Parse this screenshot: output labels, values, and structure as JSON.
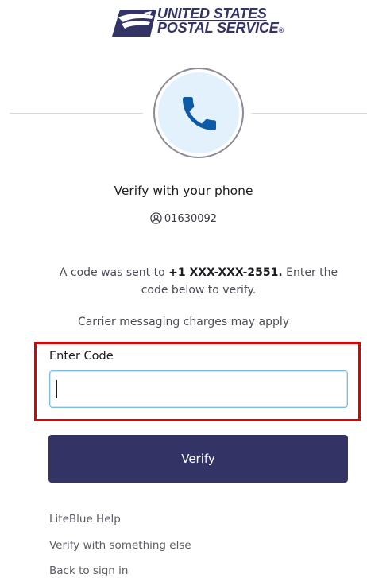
{
  "brand": {
    "line1": "UNITED STATES",
    "line2": "POSTAL SERVICE",
    "reg": "®",
    "logo_icon": "eagle-icon",
    "color": "#333366"
  },
  "header": {
    "icon": "phone-icon",
    "icon_color": "#0e5aa7",
    "circle_bg": "#e3f1fd"
  },
  "title": "Verify with your phone",
  "user": {
    "icon": "user-circle-icon",
    "id": "01630092"
  },
  "message": {
    "prefix": "A code was sent to ",
    "phone": "+1 XXX-XXX-2551.",
    "suffix": " Enter the code below to verify."
  },
  "carrier_notice": "Carrier messaging charges may apply",
  "code_field": {
    "label": "Enter Code",
    "value": "",
    "placeholder": ""
  },
  "highlight_color": "#e00000",
  "verify_button": {
    "label": "Verify",
    "color": "#333366"
  },
  "links": [
    {
      "label": "LiteBlue Help"
    },
    {
      "label": "Verify with something else"
    },
    {
      "label": "Back to sign in"
    }
  ]
}
